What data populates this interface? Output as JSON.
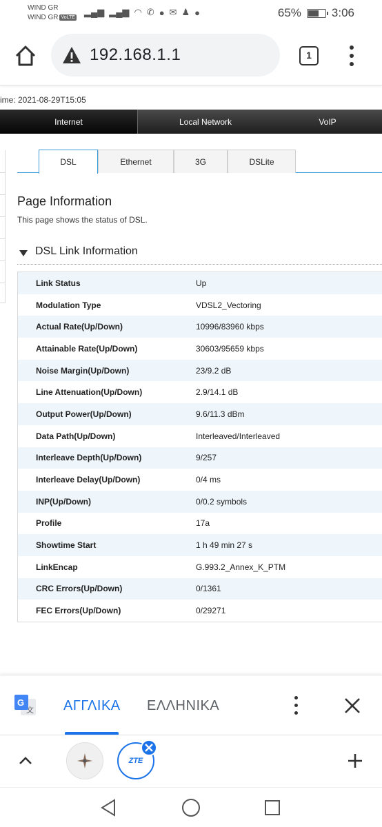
{
  "status_bar": {
    "carrier_line1": "WIND GR",
    "carrier_line2": "WIND GR",
    "volte_badge": "VoLTE",
    "battery_percent": "65%",
    "battery_level": 0.65,
    "time": "3:06"
  },
  "browser": {
    "url": "192.168.1.1",
    "tab_count": "1"
  },
  "page": {
    "time_label": "ime: 2021-08-29T15:05",
    "nav": [
      "Internet",
      "Local Network",
      "VoIP"
    ],
    "sub_tabs": [
      "DSL",
      "Ethernet",
      "3G",
      "DSLite"
    ],
    "info_title": "Page Information",
    "info_desc": "This page shows the status of DSL.",
    "section_title": "DSL Link Information",
    "rows": [
      {
        "label": "Link Status",
        "value": "Up"
      },
      {
        "label": "Modulation Type",
        "value": "VDSL2_Vectoring"
      },
      {
        "label": "Actual Rate(Up/Down)",
        "value": "10996/83960 kbps"
      },
      {
        "label": "Attainable Rate(Up/Down)",
        "value": "30603/95659 kbps"
      },
      {
        "label": "Noise Margin(Up/Down)",
        "value": "23/9.2 dB"
      },
      {
        "label": "Line Attenuation(Up/Down)",
        "value": "2.9/14.1 dB"
      },
      {
        "label": "Output Power(Up/Down)",
        "value": "9.6/11.3 dBm"
      },
      {
        "label": "Data Path(Up/Down)",
        "value": "Interleaved/Interleaved"
      },
      {
        "label": "Interleave Depth(Up/Down)",
        "value": "9/257"
      },
      {
        "label": "Interleave Delay(Up/Down)",
        "value": "0/4 ms"
      },
      {
        "label": "INP(Up/Down)",
        "value": "0/0.2 symbols"
      },
      {
        "label": "Profile",
        "value": "17a"
      },
      {
        "label": "Showtime Start",
        "value": "1 h 49 min 27 s"
      },
      {
        "label": "LinkEncap",
        "value": "G.993.2_Annex_K_PTM"
      },
      {
        "label": "CRC Errors(Up/Down)",
        "value": "0/1361"
      },
      {
        "label": "FEC Errors(Up/Down)",
        "value": "0/29271"
      }
    ]
  },
  "translate": {
    "lang_active": "ΑΓΓΛΙΚΑ",
    "lang_other": "ΕΛΛΗΝΙΚΑ"
  },
  "bottom_toolbar": {
    "tab2_label": "ZTE"
  },
  "colors": {
    "accent": "#1a73e8",
    "tab_border": "#3a9ad9",
    "row_alt": "#eef5fb"
  }
}
